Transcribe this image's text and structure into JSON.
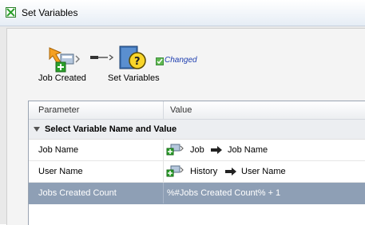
{
  "window": {
    "title": "Set Variables"
  },
  "workflow": {
    "nodes": [
      {
        "label": "Job Created",
        "icon": "job-created-icon"
      },
      {
        "label": "Set Variables",
        "icon": "set-variables-icon"
      }
    ],
    "changed_label": "Changed",
    "changed_checked": true
  },
  "grid": {
    "columns": [
      "Parameter",
      "Value"
    ],
    "group_label": "Select Variable Name and Value",
    "rows": [
      {
        "name": "Job Name",
        "source": "Job",
        "target": "Job Name"
      },
      {
        "name": "User Name",
        "source": "History",
        "target": "User Name"
      },
      {
        "name": "Jobs Created Count",
        "value": "%#Jobs Created Count% + 1"
      }
    ]
  },
  "colors": {
    "selected_row": "#8e9fb5",
    "changed_text": "#1f3fb0",
    "node_accent": "#f5a020"
  }
}
